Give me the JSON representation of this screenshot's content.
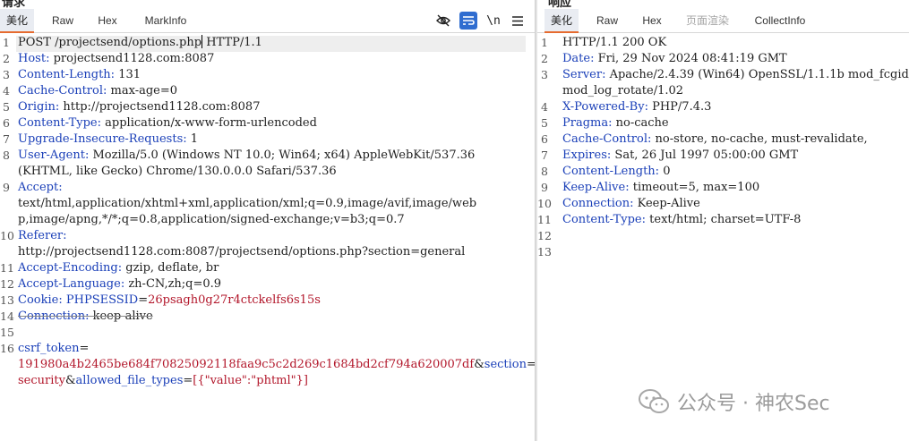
{
  "request": {
    "title": "请求",
    "tabs": [
      "美化",
      "Raw",
      "Hex",
      "MarkInfo"
    ],
    "active_tab": 0,
    "toolbar_icons": [
      "eye-slash-icon",
      "wrap-lines-icon",
      "newline-icon",
      "menu-icon"
    ],
    "lines": [
      {
        "n": "1",
        "key": "",
        "val": "POST /projectsend/options.php"
      },
      {
        "n": "2",
        "key": "Host",
        "val": " projectsend1128.com:8087"
      },
      {
        "n": "3",
        "key": "Content-Length",
        "val": " 131"
      },
      {
        "n": "4",
        "key": "Cache-Control",
        "val": " max-age=0"
      },
      {
        "n": "5",
        "key": "Origin",
        "val": " http://projectsend1128.com:8087"
      },
      {
        "n": "6",
        "key": "Content-Type",
        "val": " application/x-www-form-urlencoded"
      },
      {
        "n": "7",
        "key": "Upgrade-Insecure-Requests",
        "val": " 1"
      },
      {
        "n": "8",
        "key": "User-Agent",
        "val": " Mozilla/5.0 (Windows NT 10.0; Win64; x64) AppleWebKit/537.36"
      },
      {
        "n": "",
        "key": "",
        "val": "(KHTML, like Gecko) Chrome/130.0.0.0 Safari/537.36"
      },
      {
        "n": "9",
        "key": "Accept",
        "val": ""
      },
      {
        "n": "",
        "key": "",
        "val": "text/html,application/xhtml+xml,application/xml;q=0.9,image/avif,image/web"
      },
      {
        "n": "",
        "key": "",
        "val": "p,image/apng,*/*;q=0.8,application/signed-exchange;v=b3;q=0.7"
      },
      {
        "n": "10",
        "key": "Referer",
        "val": ""
      },
      {
        "n": "",
        "key": "",
        "val": "http://projectsend1128.com:8087/projectsend/options.php?section=general"
      },
      {
        "n": "11",
        "key": "Accept-Encoding",
        "val": " gzip, deflate, br"
      },
      {
        "n": "12",
        "key": "Accept-Language",
        "val": " zh-CN,zh;q=0.9"
      },
      {
        "n": "13",
        "key": "Cookie",
        "val": ""
      },
      {
        "n": "14",
        "key": "Connection",
        "val": " keep-alive"
      },
      {
        "n": "15",
        "key": "",
        "val": ""
      },
      {
        "n": "16",
        "key": "",
        "val": ""
      },
      {
        "n": "",
        "key": "",
        "val": ""
      },
      {
        "n": "",
        "key": "",
        "val": ""
      }
    ],
    "http_version": " HTTP/1.1",
    "cookie_name": "PHPSESSID",
    "cookie_value": "26psagh0g27r4ctckelfs6s15s",
    "body": {
      "p1_name": "csrf_token",
      "p1_eq": "=",
      "p1_value": "191980a4b2465be684f70825092118faa9c5c2d269c1684bd2cf794a620007df",
      "amp1": "&",
      "p2_name": "section",
      "p2_eq": "=",
      "p2_value": "security",
      "amp2": "&",
      "p3_name": "allowed_file_types",
      "p3_eq": "=",
      "p3_value": "[{\"value\":\"phtml\"}]"
    }
  },
  "response": {
    "title": "响应",
    "tabs": [
      "美化",
      "Raw",
      "Hex",
      "页面渲染",
      "CollectInfo"
    ],
    "active_tab": 0,
    "lines": [
      {
        "n": "1",
        "key": "",
        "val": "HTTP/1.1 200 OK"
      },
      {
        "n": "2",
        "key": "Date",
        "val": " Fri, 29 Nov 2024 08:41:19 GMT"
      },
      {
        "n": "3",
        "key": "Server",
        "val": " Apache/2.4.39 (Win64) OpenSSL/1.1.1b mod_fcgid/2.3.9a"
      },
      {
        "n": "",
        "key": "",
        "val": "mod_log_rotate/1.02"
      },
      {
        "n": "4",
        "key": "X-Powered-By",
        "val": " PHP/7.4.3"
      },
      {
        "n": "5",
        "key": "Pragma",
        "val": " no-cache"
      },
      {
        "n": "6",
        "key": "Cache-Control",
        "val": " no-store, no-cache, must-revalidate,"
      },
      {
        "n": "7",
        "key": "Expires",
        "val": " Sat, 26 Jul 1997 05:00:00 GMT"
      },
      {
        "n": "8",
        "key": "Content-Length",
        "val": " 0"
      },
      {
        "n": "9",
        "key": "Keep-Alive",
        "val": " timeout=5, max=100"
      },
      {
        "n": "10",
        "key": "Connection",
        "val": " Keep-Alive"
      },
      {
        "n": "11",
        "key": "Content-Type",
        "val": " text/html; charset=UTF-8"
      },
      {
        "n": "12",
        "key": "",
        "val": ""
      },
      {
        "n": "13",
        "key": "",
        "val": ""
      }
    ]
  },
  "watermark": {
    "text": "公众号 · 神农Sec"
  }
}
